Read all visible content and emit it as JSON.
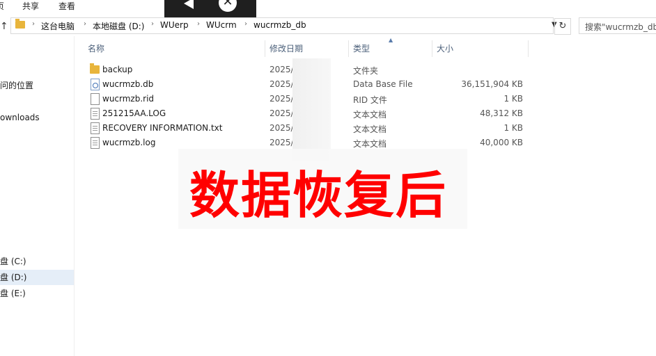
{
  "ribbon": {
    "tab_partial": "页",
    "share": "共享",
    "view": "查看"
  },
  "address_bar": {
    "breadcrumbs": [
      "这台电脑",
      "本地磁盘 (D:)",
      "WUerp",
      "WUcrm",
      "wucrmzb_db"
    ],
    "dropdown_icon": "chevron-down-icon",
    "refresh_icon": "refresh-icon"
  },
  "search": {
    "placeholder": "搜索\"wucrmzb_db\""
  },
  "sidebar": {
    "recent": "问的位置",
    "downloads": "ownloads",
    "drives": [
      {
        "label": "盘 (C:)",
        "selected": false
      },
      {
        "label": "盘 (D:)",
        "selected": true
      },
      {
        "label": "盘 (E:)",
        "selected": false
      }
    ]
  },
  "columns": {
    "name": "名称",
    "date": "修改日期",
    "type": "类型",
    "size": "大小"
  },
  "files": [
    {
      "name": "backup",
      "date": "2025/",
      "type": "文件夹",
      "size": "",
      "icon": "folder-icon"
    },
    {
      "name": "wucrmzb.db",
      "date": "2025/",
      "type": "Data Base File",
      "size": "36,151,904 KB",
      "icon": "database-file-icon"
    },
    {
      "name": "wucrmzb.rid",
      "date": "2025/",
      "type": "RID 文件",
      "size": "1 KB",
      "icon": "blank-file-icon"
    },
    {
      "name": "251215AA.LOG",
      "date": "2025/",
      "type": "文本文档",
      "size": "48,312 KB",
      "icon": "text-file-icon"
    },
    {
      "name": "RECOVERY INFORMATION.txt",
      "date": "2025/",
      "type": "文本文档",
      "size": "1 KB",
      "icon": "text-file-icon"
    },
    {
      "name": "wucrmzb.log",
      "date": "2025/",
      "type": "文本文档",
      "size": "40,000 KB",
      "icon": "text-file-icon"
    }
  ],
  "watermark": "数据恢复后",
  "colors": {
    "watermark": "#ff0000",
    "folder": "#e8b53c",
    "selection": "#e5eef8",
    "header_text": "#4c607a"
  }
}
